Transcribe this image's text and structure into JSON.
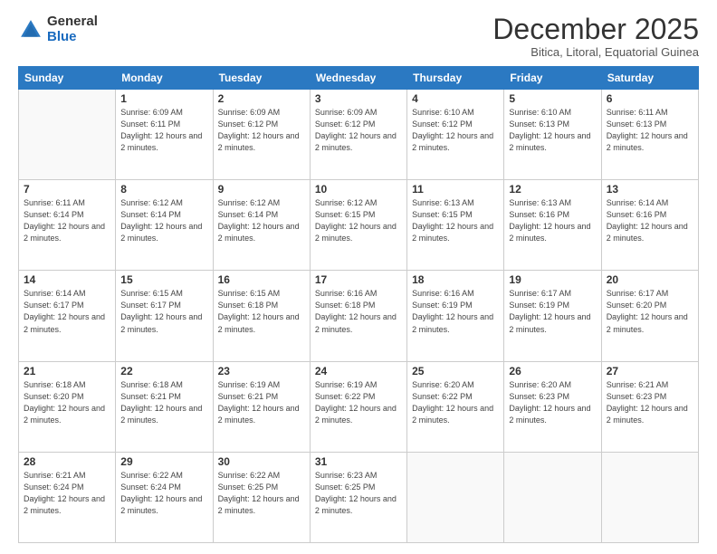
{
  "logo": {
    "general": "General",
    "blue": "Blue"
  },
  "header": {
    "month": "December 2025",
    "location": "Bitica, Litoral, Equatorial Guinea"
  },
  "weekdays": [
    "Sunday",
    "Monday",
    "Tuesday",
    "Wednesday",
    "Thursday",
    "Friday",
    "Saturday"
  ],
  "weeks": [
    [
      {
        "day": "",
        "info": ""
      },
      {
        "day": "1",
        "info": "Sunrise: 6:09 AM\nSunset: 6:11 PM\nDaylight: 12 hours and 2 minutes."
      },
      {
        "day": "2",
        "info": "Sunrise: 6:09 AM\nSunset: 6:12 PM\nDaylight: 12 hours and 2 minutes."
      },
      {
        "day": "3",
        "info": "Sunrise: 6:09 AM\nSunset: 6:12 PM\nDaylight: 12 hours and 2 minutes."
      },
      {
        "day": "4",
        "info": "Sunrise: 6:10 AM\nSunset: 6:12 PM\nDaylight: 12 hours and 2 minutes."
      },
      {
        "day": "5",
        "info": "Sunrise: 6:10 AM\nSunset: 6:13 PM\nDaylight: 12 hours and 2 minutes."
      },
      {
        "day": "6",
        "info": "Sunrise: 6:11 AM\nSunset: 6:13 PM\nDaylight: 12 hours and 2 minutes."
      }
    ],
    [
      {
        "day": "7",
        "info": "Sunrise: 6:11 AM\nSunset: 6:14 PM\nDaylight: 12 hours and 2 minutes."
      },
      {
        "day": "8",
        "info": "Sunrise: 6:12 AM\nSunset: 6:14 PM\nDaylight: 12 hours and 2 minutes."
      },
      {
        "day": "9",
        "info": "Sunrise: 6:12 AM\nSunset: 6:14 PM\nDaylight: 12 hours and 2 minutes."
      },
      {
        "day": "10",
        "info": "Sunrise: 6:12 AM\nSunset: 6:15 PM\nDaylight: 12 hours and 2 minutes."
      },
      {
        "day": "11",
        "info": "Sunrise: 6:13 AM\nSunset: 6:15 PM\nDaylight: 12 hours and 2 minutes."
      },
      {
        "day": "12",
        "info": "Sunrise: 6:13 AM\nSunset: 6:16 PM\nDaylight: 12 hours and 2 minutes."
      },
      {
        "day": "13",
        "info": "Sunrise: 6:14 AM\nSunset: 6:16 PM\nDaylight: 12 hours and 2 minutes."
      }
    ],
    [
      {
        "day": "14",
        "info": "Sunrise: 6:14 AM\nSunset: 6:17 PM\nDaylight: 12 hours and 2 minutes."
      },
      {
        "day": "15",
        "info": "Sunrise: 6:15 AM\nSunset: 6:17 PM\nDaylight: 12 hours and 2 minutes."
      },
      {
        "day": "16",
        "info": "Sunrise: 6:15 AM\nSunset: 6:18 PM\nDaylight: 12 hours and 2 minutes."
      },
      {
        "day": "17",
        "info": "Sunrise: 6:16 AM\nSunset: 6:18 PM\nDaylight: 12 hours and 2 minutes."
      },
      {
        "day": "18",
        "info": "Sunrise: 6:16 AM\nSunset: 6:19 PM\nDaylight: 12 hours and 2 minutes."
      },
      {
        "day": "19",
        "info": "Sunrise: 6:17 AM\nSunset: 6:19 PM\nDaylight: 12 hours and 2 minutes."
      },
      {
        "day": "20",
        "info": "Sunrise: 6:17 AM\nSunset: 6:20 PM\nDaylight: 12 hours and 2 minutes."
      }
    ],
    [
      {
        "day": "21",
        "info": "Sunrise: 6:18 AM\nSunset: 6:20 PM\nDaylight: 12 hours and 2 minutes."
      },
      {
        "day": "22",
        "info": "Sunrise: 6:18 AM\nSunset: 6:21 PM\nDaylight: 12 hours and 2 minutes."
      },
      {
        "day": "23",
        "info": "Sunrise: 6:19 AM\nSunset: 6:21 PM\nDaylight: 12 hours and 2 minutes."
      },
      {
        "day": "24",
        "info": "Sunrise: 6:19 AM\nSunset: 6:22 PM\nDaylight: 12 hours and 2 minutes."
      },
      {
        "day": "25",
        "info": "Sunrise: 6:20 AM\nSunset: 6:22 PM\nDaylight: 12 hours and 2 minutes."
      },
      {
        "day": "26",
        "info": "Sunrise: 6:20 AM\nSunset: 6:23 PM\nDaylight: 12 hours and 2 minutes."
      },
      {
        "day": "27",
        "info": "Sunrise: 6:21 AM\nSunset: 6:23 PM\nDaylight: 12 hours and 2 minutes."
      }
    ],
    [
      {
        "day": "28",
        "info": "Sunrise: 6:21 AM\nSunset: 6:24 PM\nDaylight: 12 hours and 2 minutes."
      },
      {
        "day": "29",
        "info": "Sunrise: 6:22 AM\nSunset: 6:24 PM\nDaylight: 12 hours and 2 minutes."
      },
      {
        "day": "30",
        "info": "Sunrise: 6:22 AM\nSunset: 6:25 PM\nDaylight: 12 hours and 2 minutes."
      },
      {
        "day": "31",
        "info": "Sunrise: 6:23 AM\nSunset: 6:25 PM\nDaylight: 12 hours and 2 minutes."
      },
      {
        "day": "",
        "info": ""
      },
      {
        "day": "",
        "info": ""
      },
      {
        "day": "",
        "info": ""
      }
    ]
  ]
}
